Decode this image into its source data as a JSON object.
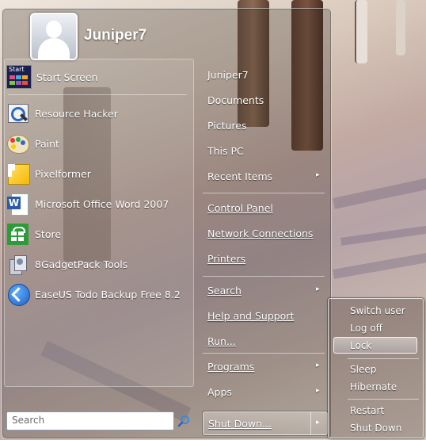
{
  "user": {
    "name": "Juniper7"
  },
  "programs": [
    {
      "label": "Start Screen",
      "icon": "start-screen-icon"
    },
    {
      "label": "Resource Hacker",
      "icon": "resource-hacker-icon"
    },
    {
      "label": "Paint",
      "icon": "paint-palette-icon"
    },
    {
      "label": "Pixelformer",
      "icon": "pixelformer-icon"
    },
    {
      "label": "Microsoft Office Word 2007",
      "icon": "word-icon"
    },
    {
      "label": "Store",
      "icon": "store-icon"
    },
    {
      "label": "8GadgetPack Tools",
      "icon": "gadgetpack-icon"
    },
    {
      "label": "EaseUS Todo Backup Free 8.2",
      "icon": "easeus-icon"
    }
  ],
  "start_icon_text": "Start",
  "places": [
    {
      "label": "Juniper7"
    },
    {
      "label": "Documents"
    },
    {
      "label": "Pictures"
    },
    {
      "label": "This PC"
    },
    {
      "label": "Recent Items",
      "submenu": true
    },
    {
      "label": "Control Panel"
    },
    {
      "label": "Network Connections"
    },
    {
      "label": "Printers"
    },
    {
      "label": "Search",
      "submenu": true
    },
    {
      "label": "Help and Support"
    },
    {
      "label": "Run..."
    },
    {
      "label": "Programs",
      "submenu": true
    },
    {
      "label": "Apps",
      "submenu": true
    }
  ],
  "search": {
    "placeholder": "Search"
  },
  "shutdown": {
    "label": "Shut Down...",
    "arrow": "▸"
  },
  "power_submenu": [
    {
      "label": "Switch user"
    },
    {
      "label": "Log off"
    },
    {
      "label": "Lock",
      "highlighted": true
    },
    {
      "label": "Sleep"
    },
    {
      "label": "Hibernate"
    },
    {
      "label": "Restart"
    },
    {
      "label": "Shut Down"
    }
  ],
  "submenu_arrow": "▸",
  "colors": {
    "accent": "#2a63c4",
    "store_green": "#2e9b3a",
    "word_blue": "#2b5aa8"
  }
}
